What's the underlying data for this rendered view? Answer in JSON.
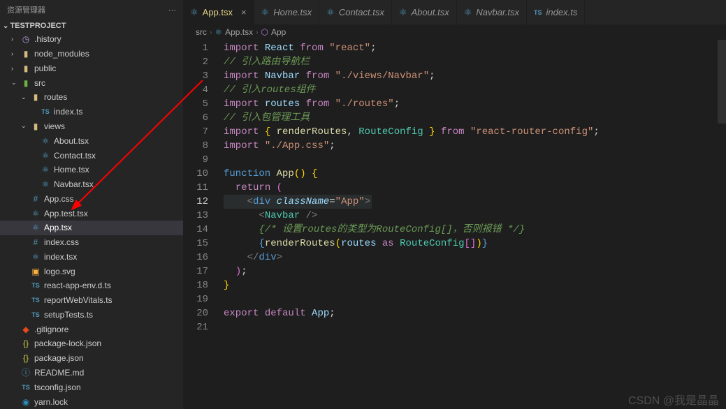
{
  "explorer": {
    "title": "资源管理器",
    "project": "TESTPROJECT"
  },
  "tree": {
    "history": ".history",
    "node_modules": "node_modules",
    "public": "public",
    "src": "src",
    "routes": "routes",
    "routes_index": "index.ts",
    "views": "views",
    "about": "About.tsx",
    "contact": "Contact.tsx",
    "home": "Home.tsx",
    "navbar": "Navbar.tsx",
    "appcss": "App.css",
    "apptest": "App.test.tsx",
    "apptsx": "App.tsx",
    "indexcss": "index.css",
    "indextsx": "index.tsx",
    "logo": "logo.svg",
    "reactenv": "react-app-env.d.ts",
    "reportweb": "reportWebVitals.ts",
    "setuptests": "setupTests.ts",
    "gitignore": ".gitignore",
    "pkglock": "package-lock.json",
    "pkg": "package.json",
    "readme": "README.md",
    "tsconfig": "tsconfig.json",
    "yarnlock": "yarn.lock"
  },
  "tabs": [
    {
      "label": "App.tsx",
      "active": true
    },
    {
      "label": "Home.tsx"
    },
    {
      "label": "Contact.tsx"
    },
    {
      "label": "About.tsx"
    },
    {
      "label": "Navbar.tsx"
    },
    {
      "label": "index.ts",
      "ts": true
    }
  ],
  "breadcrumb": {
    "a": "src",
    "b": "App.tsx",
    "c": "App"
  },
  "code": {
    "l1": {
      "kw1": "import",
      "id": "React",
      "kw2": "from",
      "str": "\"react\""
    },
    "l2": "// 引入路由导航栏",
    "l3": {
      "kw1": "import",
      "id": "Navbar",
      "kw2": "from",
      "str": "\"./views/Navbar\""
    },
    "l4": "// 引入routes组件",
    "l5": {
      "kw1": "import",
      "id": "routes",
      "kw2": "from",
      "str": "\"./routes\""
    },
    "l6": "// 引入包管理工具",
    "l7": {
      "kw1": "import",
      "fn": "renderRoutes",
      "type": "RouteConfig",
      "kw2": "from",
      "str": "\"react-router-config\""
    },
    "l8": {
      "kw1": "import",
      "str": "\"./App.css\""
    },
    "l10": {
      "kw": "function",
      "fn": "App"
    },
    "l11": {
      "kw": "return"
    },
    "l12": {
      "tag": "div",
      "attr": "className",
      "val": "\"App\""
    },
    "l13": {
      "tag": "Navbar"
    },
    "l14": "{/* 设置routes的类型为RouteConfig[]，否则报错 */}",
    "l15": {
      "fn": "renderRoutes",
      "id": "routes",
      "kw": "as",
      "type": "RouteConfig"
    },
    "l16": {
      "tag": "div"
    },
    "l20": {
      "kw1": "export",
      "kw2": "default",
      "id": "App"
    }
  },
  "watermark": "CSDN @我是晶晶"
}
